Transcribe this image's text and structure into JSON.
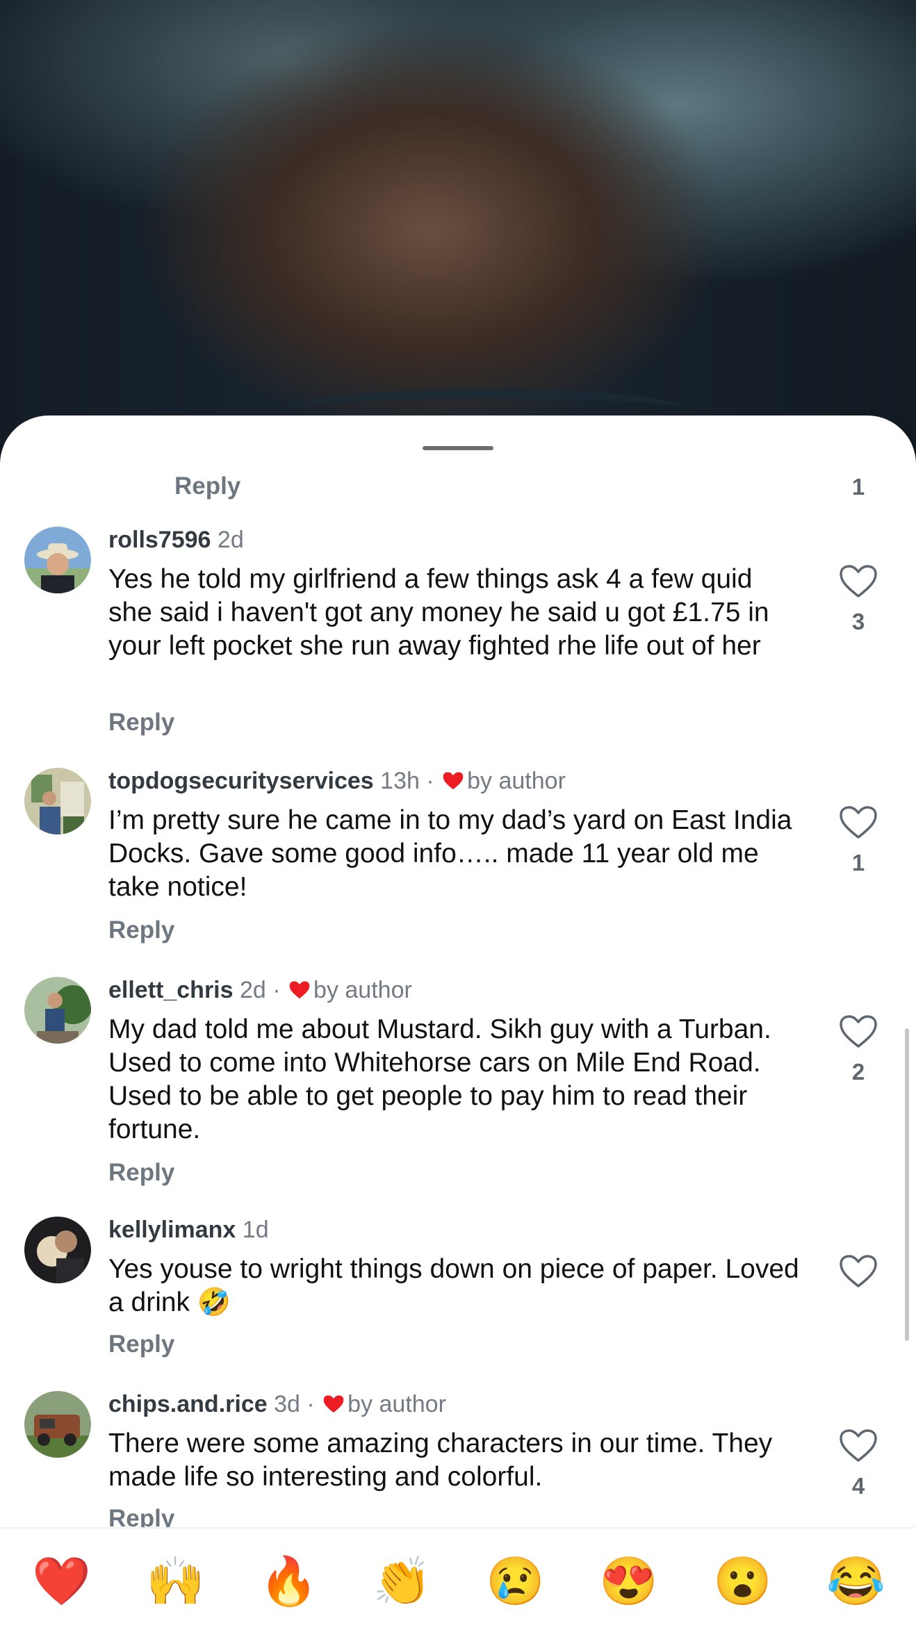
{
  "top_row": {
    "reply_label": "Reply",
    "like_count": "1"
  },
  "comments": [
    {
      "username": "rolls7596",
      "time": "2d",
      "author_liked": false,
      "text": "Yes he told my girlfriend a few things ask 4 a few quid she said i haven't got any money he said u got £1.75 in your left pocket she run away fighted rhe life out of her",
      "reply_label": "Reply",
      "likes": "3"
    },
    {
      "username": "topdogsecurityservices",
      "time": "13h",
      "author_liked": true,
      "author_tag": "by author",
      "text": "I’m pretty sure he came in to my dad’s yard on East India Docks.  Gave some good info….. made 11 year old me take notice!",
      "reply_label": "Reply",
      "likes": "1"
    },
    {
      "username": "ellett_chris",
      "time": "2d",
      "author_liked": true,
      "author_tag": "by author",
      "text": "My dad told me about Mustard. Sikh guy with a Turban. Used to come into Whitehorse cars on Mile End Road. Used to be able to get people to pay him to read their fortune.",
      "reply_label": "Reply",
      "likes": "2"
    },
    {
      "username": "kellylimanx",
      "time": "1d",
      "author_liked": false,
      "text": "Yes youse to wright things down on piece of paper. Loved a drink 🤣",
      "reply_label": "Reply",
      "likes": ""
    },
    {
      "username": "chips.and.rice",
      "time": "3d",
      "author_liked": true,
      "author_tag": "by author",
      "text": "There were some amazing characters in our time. They made life so interesting and colorful.",
      "reply_label": "Reply",
      "likes": "4"
    }
  ],
  "separator": "·",
  "emoji_bar": [
    "❤️",
    "🙌",
    "🔥",
    "👏",
    "😢",
    "😍",
    "😮",
    "😂"
  ],
  "colors": {
    "heart_red": "#ed1c24",
    "username": "#333a42",
    "meta_gray": "#737a83",
    "text": "#111111"
  }
}
